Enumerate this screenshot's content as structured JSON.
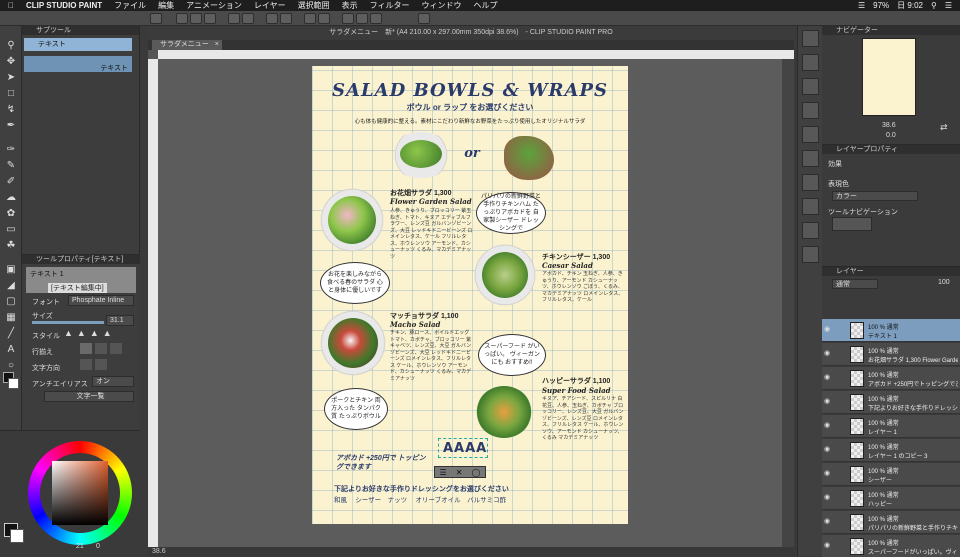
{
  "menubar": {
    "app_name": "CLIP STUDIO PAINT",
    "items": [
      "ファイル",
      "編集",
      "アニメーション",
      "レイヤー",
      "選択範囲",
      "表示",
      "フィルター",
      "ウィンドウ",
      "ヘルプ"
    ],
    "battery": "97%",
    "clock": "日 9:02"
  },
  "window": {
    "title": "サラダメニュー　新* (A4 210.00 x 297.00mm 350dpi 38.6%)　- CLIP STUDIO PAINT PRO",
    "tab": "サラダメニュー"
  },
  "subtool": {
    "header": "サブツール",
    "items": [
      "テキスト",
      "テキスト"
    ]
  },
  "toolprop": {
    "header": "ツールプロパティ[テキスト]",
    "preview_label": "テキスト 1",
    "edit_label": "[テキスト編集中]",
    "font_label": "フォント",
    "font_value": "Phosphate Inline",
    "size_label": "サイズ",
    "size_value": "31.1",
    "style_label": "スタイル",
    "align_label": "行揃え",
    "direction_label": "文字方向",
    "aa_label": "アンチエイリアス",
    "aa_value": "オン",
    "more_label": "文字一覧"
  },
  "color": {
    "value_r": "21",
    "value_g": "0",
    "accent": "#e06030"
  },
  "status": {
    "zoom": "38.6"
  },
  "menu": {
    "title": "SALAD BOWLS & WRAPS",
    "subtitle": "ボウル or ラップ をお選びください",
    "intro": "心も体も健康的に整える。素材にこだわり新鮮なお野菜をたっぷり使用したオリジナルサラダ",
    "or": "or",
    "items": [
      {
        "jp_name": "お花畑サラダ 1,300",
        "en_name": "Flower Garden Salad",
        "desc": "人参、きゅうり、ブロッコリー 紫玉ねぎ、トマト、キヌア エディブルフラワー、レンズ豆 ガルバンゾビーンズ、大豆 レッドキドニービーンズ ロメインレタス、ケール フリルレタス、ホウレンソウ アーモンド、カシューナッツ くるみ、マカデミアナッツ"
      },
      {
        "jp_name": "チキンシーザー 1,300",
        "en_name": "Caesar Salad",
        "desc": "アボカド、チキン 玉ねぎ、人参、きゅうり、アーモンド カシューナッツ、ホウレンソウ ごぼう、くるみ、マカデミアナッツ ロメインレタス、フリルレタス、ケール"
      },
      {
        "jp_name": "マッチョサラダ 1,100",
        "en_name": "Macho Salad",
        "desc": "チキン、豚ロース、ボイルドエッグ トマト、カボチャ、ブロッコリー 紫キャベツ、レンズ豆、大豆 ガルバンゾビーンズ、大豆 レッドキドニービーンズ ロメインレタス、フリルレタス ケール、ホウレンソウ アーモンド、カシューナッツ くるみ、マカデミアナッツ"
      },
      {
        "jp_name": "ハッピーサラダ 1,100",
        "en_name": "Super Food Salad",
        "desc": "キヌア、チアシード、スピルリナ 白花豆、人参、玉ねぎ、カボチャ ブロッコリー、レンズ豆、大豆 ガルバンゾビーンズ、レンズ豆 ロメインレタス、フリルレタス ケール、ホウレンソウ、アーモンド カシューナッツ、くるみ マカデミアナッツ"
      }
    ],
    "bubbles": [
      "パリパリの新鮮野菜と手作りチキンハム たっぷりアボカドを 自家製シーザー ドレッシングで",
      "お花を楽しみながら 食べる春のサラダ 心と身体に優しいです",
      "スーパーフード がいっぱい。 ヴィーガンにも おすすめ!!",
      "ポークとチキン 両方入った タンパク質 たっぷりボウル"
    ],
    "edit_text": "AAAA",
    "avocado": "アボカド +250円で トッピングできます",
    "dressing": "下記よりお好きな手作りドレッシングをお選びください",
    "dressings": "和風　 シーザー　ナッツ　 オリーブオイル　バルサミコ酢"
  },
  "navigator": {
    "header": "ナビゲーター",
    "zoom": "38.6",
    "angle": "0.0"
  },
  "layerprop": {
    "header": "レイヤープロパティ",
    "effect_label": "効果",
    "color_label": "表現色",
    "color_value": "カラー",
    "toolnav_label": "ツールナビゲーション"
  },
  "layers": {
    "header": "レイヤー",
    "blend": "通常",
    "opacity": "100",
    "rows": [
      {
        "mode": "100 % 通常",
        "name": "テキスト 1"
      },
      {
        "mode": "100 % 通常",
        "name": "お花畑サラダ 1,300 Flower Garden Sal..."
      },
      {
        "mode": "100 % 通常",
        "name": "アボカド +250円でトッピングできます"
      },
      {
        "mode": "100 % 通常",
        "name": "下記よりお好きな手作りドレッシングを..."
      },
      {
        "mode": "100 % 通常",
        "name": "レイヤー 1"
      },
      {
        "mode": "100 % 通常",
        "name": "レイヤー 1 のコピー 3"
      },
      {
        "mode": "100 % 通常",
        "name": "シーザー"
      },
      {
        "mode": "100 % 通常",
        "name": "ハッピー"
      },
      {
        "mode": "100 % 通常",
        "name": "パリパリの新鮮野菜と手作りチキンハム"
      },
      {
        "mode": "100 % 通常",
        "name": "スーパーフードがいっぱい。ヴィーガ..."
      }
    ]
  }
}
